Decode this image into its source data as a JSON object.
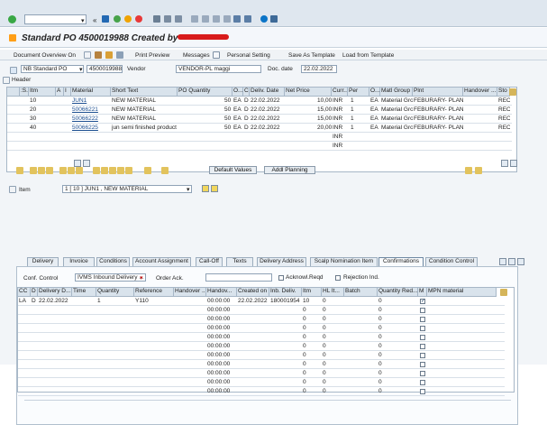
{
  "toolbar": {
    "command_value": "",
    "icons": [
      "check-icon",
      "dropdown-icon",
      "back-icon",
      "save-icon",
      "exit-icon",
      "cancel-icon",
      "print-icon",
      "find-icon",
      "next-icon",
      "first-page-icon",
      "prev-page-icon",
      "next-page-icon",
      "last-page-icon",
      "layout-icon",
      "help-icon",
      "settings-icon"
    ]
  },
  "title": {
    "text": "Standard PO 4500019988 Created by"
  },
  "menu": {
    "document_overview": "Document Overview On",
    "print_preview": "Print Preview",
    "messages": "Messages",
    "personal_setting": "Personal Setting",
    "save_template": "Save As Template",
    "load_template": "Load from Template"
  },
  "header": {
    "po_type": "NB Standard PO",
    "po_number": "4500019988",
    "vendor_label": "Vendor",
    "vendor_value": "VENDOR-PL maggi",
    "doc_date_label": "Doc. date",
    "doc_date_value": "22.02.2022",
    "section_label": "Header"
  },
  "items_table": {
    "headers": [
      "",
      ":S..",
      "Itm",
      "A",
      "I",
      "Material",
      "Short Text",
      "PO Quantity",
      "O...",
      "C",
      "Deliv. Date",
      "Net Price",
      "Curr...",
      "Per",
      "O...",
      "Matl Group",
      "Plnt",
      "Handover ...",
      "Sto"
    ],
    "rows": [
      [
        "",
        "",
        "10",
        "",
        "",
        "JUN1",
        "NEW MATERIAL",
        "50",
        "EA",
        "D",
        "22.02.2022",
        "10,00",
        "INR",
        "1",
        "EA",
        "Material Gro...",
        "FEBURARY- PLANT...",
        "",
        "REC"
      ],
      [
        "",
        "",
        "20",
        "",
        "",
        "50066221",
        "NEW MATERIAL",
        "50",
        "EA",
        "D",
        "22.02.2022",
        "15,00",
        "INR",
        "1",
        "EA",
        "Material Gro...",
        "FEBURARY- PLANT...",
        "",
        "REC"
      ],
      [
        "",
        "",
        "30",
        "",
        "",
        "50066222",
        "NEW MATERIAL",
        "50",
        "EA",
        "D",
        "22.02.2022",
        "15,00",
        "INR",
        "1",
        "EA",
        "Material Gro...",
        "FEBURARY- PLANT...",
        "",
        "REC"
      ],
      [
        "",
        "",
        "40",
        "",
        "",
        "50066225",
        "jun semi finished product",
        "50",
        "EA",
        "D",
        "22.02.2022",
        "20,00",
        "INR",
        "1",
        "EA",
        "Material Gro...",
        "FEBURARY- PLANT...",
        "",
        "REC"
      ],
      [
        "",
        "",
        "",
        "",
        "",
        "",
        "",
        "",
        "",
        "",
        "",
        "",
        "INR",
        "",
        "",
        "",
        "",
        "",
        ""
      ],
      [
        "",
        "",
        "",
        "",
        "",
        "",
        "",
        "",
        "",
        "",
        "",
        "",
        "INR",
        "",
        "",
        "",
        "",
        "",
        ""
      ]
    ]
  },
  "item_buttons": {
    "default_values": "Default Values",
    "addl_planning": "Addl Planning"
  },
  "item": {
    "label": "Item",
    "selected": "1 [ 10 ] JUN1 , NEW MATERIAL"
  },
  "tabs": [
    "Delivery",
    "Invoice",
    "Conditions",
    "Account Assignment",
    "Call-Off",
    "Texts",
    "Delivery Address",
    "Scalp Nomination Item",
    "Confirmations",
    "Condition Control"
  ],
  "confirmations": {
    "conf_control_label": "Conf. Control",
    "conf_control_value": "IVMS Inbound Delivery ...",
    "order_ack_label": "Order Ack.",
    "order_ack_value": "",
    "acknowl_label": "Acknowl.Reqd",
    "rejection_label": "Rejection Ind.",
    "headers": [
      "CC",
      "D",
      "Delivery D...",
      "Time",
      "Quantity",
      "Reference",
      "Handover ...",
      "Handov...",
      "Created on",
      "Inb. Deliv.",
      "Itm",
      "HL It...",
      "Batch",
      "Quantity Red...",
      "M",
      "MPN material"
    ],
    "rows": [
      [
        "LA",
        "D",
        "22.02.2022",
        "",
        "1",
        "Y110",
        "",
        "00:00:00",
        "22.02.2022",
        "180001954",
        "10",
        "0",
        "",
        "0",
        "✓",
        ""
      ],
      [
        "",
        "",
        "",
        "",
        "",
        "",
        "",
        "00:00:00",
        "",
        "",
        "0",
        "0",
        "",
        "0",
        "",
        ""
      ],
      [
        "",
        "",
        "",
        "",
        "",
        "",
        "",
        "00:00:00",
        "",
        "",
        "0",
        "0",
        "",
        "0",
        "",
        ""
      ],
      [
        "",
        "",
        "",
        "",
        "",
        "",
        "",
        "00:00:00",
        "",
        "",
        "0",
        "0",
        "",
        "0",
        "",
        ""
      ],
      [
        "",
        "",
        "",
        "",
        "",
        "",
        "",
        "00:00:00",
        "",
        "",
        "0",
        "0",
        "",
        "0",
        "",
        ""
      ],
      [
        "",
        "",
        "",
        "",
        "",
        "",
        "",
        "00:00:00",
        "",
        "",
        "0",
        "0",
        "",
        "0",
        "",
        ""
      ],
      [
        "",
        "",
        "",
        "",
        "",
        "",
        "",
        "00:00:00",
        "",
        "",
        "0",
        "0",
        "",
        "0",
        "",
        ""
      ],
      [
        "",
        "",
        "",
        "",
        "",
        "",
        "",
        "00:00:00",
        "",
        "",
        "0",
        "0",
        "",
        "0",
        "",
        ""
      ],
      [
        "",
        "",
        "",
        "",
        "",
        "",
        "",
        "00:00:00",
        "",
        "",
        "0",
        "0",
        "",
        "0",
        "",
        ""
      ],
      [
        "",
        "",
        "",
        "",
        "",
        "",
        "",
        "00:00:00",
        "",
        "",
        "0",
        "0",
        "",
        "0",
        "",
        ""
      ],
      [
        "",
        "",
        "",
        "",
        "",
        "",
        "",
        "00:00:00",
        "",
        "",
        "0",
        "0",
        "",
        "0",
        "",
        ""
      ]
    ]
  }
}
